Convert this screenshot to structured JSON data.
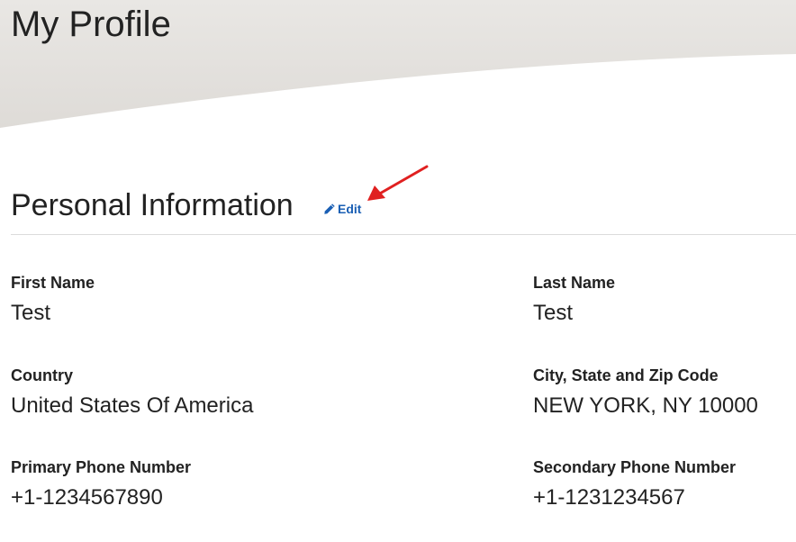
{
  "page": {
    "title": "My Profile"
  },
  "section": {
    "title": "Personal Information",
    "edit_label": "Edit",
    "edit_icon": "pencil-icon"
  },
  "fields": {
    "first_name": {
      "label": "First Name",
      "value": "Test"
    },
    "last_name": {
      "label": "Last Name",
      "value": "Test"
    },
    "country": {
      "label": "Country",
      "value": "United States Of America"
    },
    "city_state_zip": {
      "label": "City, State and Zip Code",
      "value": "NEW YORK, NY 10000"
    },
    "primary_phone": {
      "label": "Primary Phone Number",
      "value": "+1-1234567890"
    },
    "secondary_phone": {
      "label": "Secondary Phone Number",
      "value": "+1-1231234567"
    }
  },
  "colors": {
    "link": "#1a5fb4",
    "annotation_arrow": "#e02020",
    "header_band": "#e6e4e1",
    "divider": "#dcdcdc"
  }
}
